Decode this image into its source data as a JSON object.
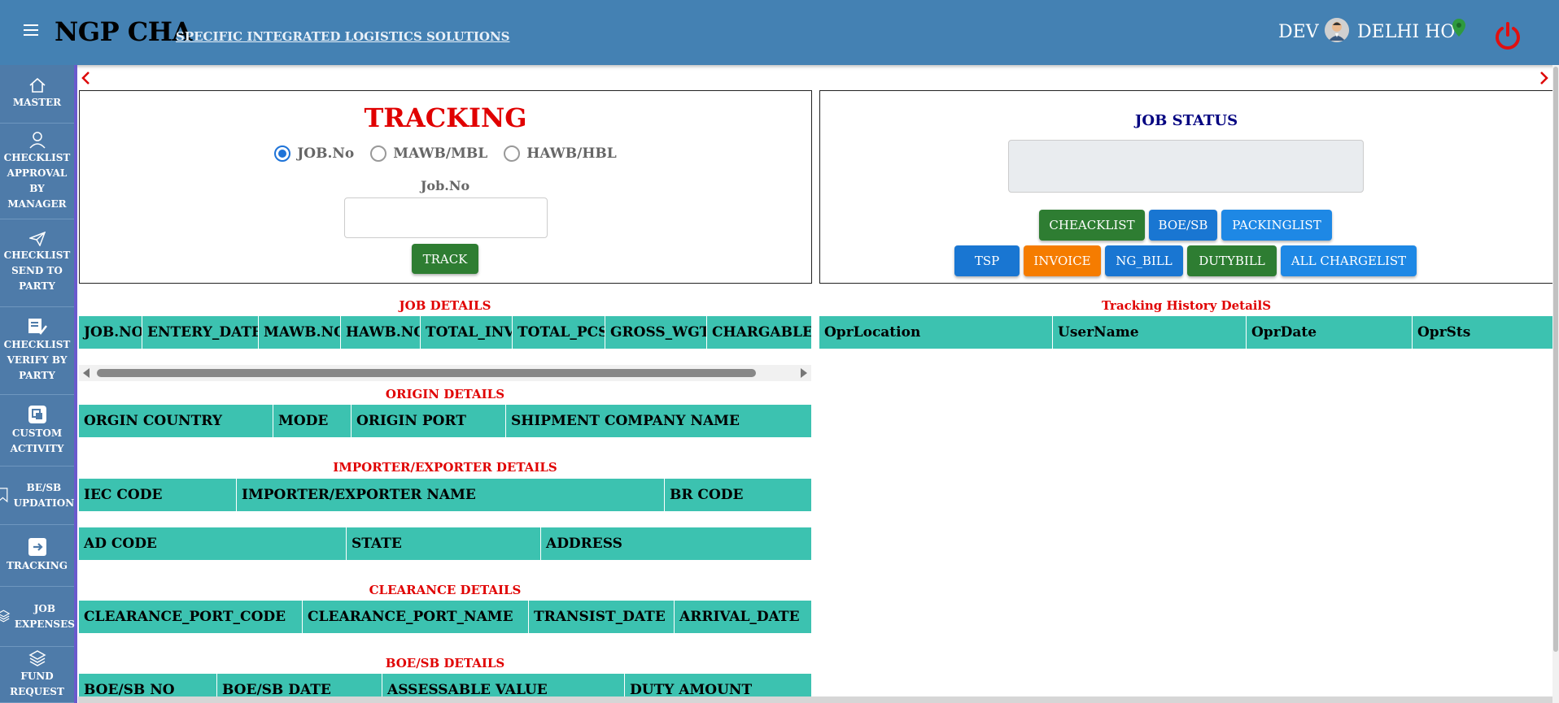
{
  "header": {
    "brand": "NGP CHA",
    "tagline": "SPECIFIC INTEGRATED LOGISTICS SOLUTIONS",
    "user": "DEV",
    "branch": "DELHI HO",
    "accent_color": "#4481b3"
  },
  "sidebar": {
    "items": [
      {
        "label": "MASTER",
        "icon": "home-icon"
      },
      {
        "label": "CHECKLIST APPROVAL BY MANAGER",
        "icon": "user-icon"
      },
      {
        "label": "CHECKLIST SEND TO PARTY",
        "icon": "send-icon"
      },
      {
        "label": "CHECKLIST VERIFY BY PARTY",
        "icon": "checklist-icon"
      },
      {
        "label": "CUSTOM ACTIVITY",
        "icon": "custom-activity-icon"
      },
      {
        "label": "BE/SB UPDATION",
        "icon": "bookmark-icon"
      },
      {
        "label": "TRACKING",
        "icon": "tracking-icon"
      },
      {
        "label": "JOB EXPENSES",
        "icon": "layers-icon"
      },
      {
        "label": "FUND REQUEST",
        "icon": "layers-icon"
      }
    ]
  },
  "tracking": {
    "title": "TRACKING",
    "radios": [
      {
        "label": "JOB.No",
        "selected": true
      },
      {
        "label": "MAWB/MBL",
        "selected": false
      },
      {
        "label": "HAWB/HBL",
        "selected": false
      }
    ],
    "field_label": "Job.No",
    "field_value": "",
    "track_button": "TRACK"
  },
  "job_status": {
    "title": "JOB STATUS",
    "buttons_row1": [
      "CHEACKLIST",
      "BOE/SB",
      "PACKINGLIST"
    ],
    "buttons_row2": [
      "TSP",
      "INVOICE",
      "NG_BILL",
      "DUTYBILL",
      "ALL CHARGELIST"
    ]
  },
  "job_details": {
    "title": "JOB DETAILS",
    "columns": [
      "JOB.NO",
      "ENTERY_DATE",
      "MAWB.NO",
      "HAWB.NO",
      "TOTAL_INV",
      "TOTAL_PCS",
      "GROSS_WGT",
      "CHARGABLE_"
    ]
  },
  "tracking_history": {
    "title": "Tracking History DetailS",
    "columns": [
      "OprLocation",
      "UserName",
      "OprDate",
      "OprSts"
    ]
  },
  "origin_details": {
    "title": "ORIGIN DETAILS",
    "columns": [
      "ORGIN COUNTRY",
      "MODE",
      "ORIGIN PORT",
      "SHIPMENT COMPANY NAME"
    ]
  },
  "importer_details": {
    "title": "IMPORTER/EXPORTER DETAILS",
    "columns": [
      "IEC CODE",
      "IMPORTER/EXPORTER NAME",
      "BR CODE"
    ],
    "columns2": [
      "AD CODE",
      "STATE",
      "ADDRESS"
    ]
  },
  "clearance_details": {
    "title": "CLEARANCE DETAILS",
    "columns": [
      "CLEARANCE_PORT_CODE",
      "CLEARANCE_PORT_NAME",
      "TRANSIST_DATE",
      "ARRIVAL_DATE"
    ]
  },
  "boe_details": {
    "title": "BOE/SB DETAILS",
    "columns": [
      "BOE/SB NO",
      "BOE/SB DATE",
      "ASSESSABLE VALUE",
      "DUTY AMOUNT"
    ]
  }
}
